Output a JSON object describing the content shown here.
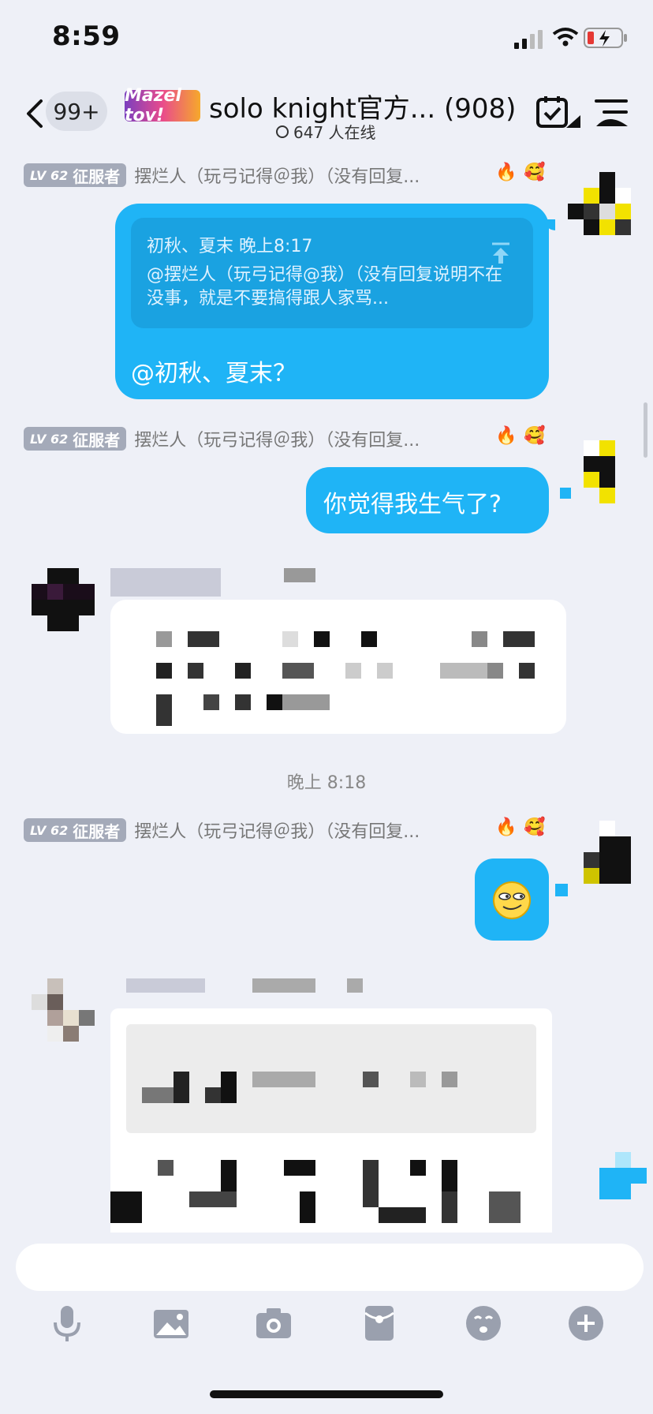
{
  "status_bar": {
    "time": "8:59"
  },
  "header": {
    "unread_badge": "99+",
    "group_logo_text": "Mazel tov!",
    "title": "solo knight官方... (908)",
    "online_count": "647 人在线"
  },
  "messages": {
    "sender": {
      "level_badge": "LV 62",
      "title": "征服者",
      "name": "摆烂人（玩弓记得＠我）（没有回复..."
    },
    "quote": {
      "meta": "初秋、夏末 晚上8:17",
      "text": "@摆烂人（玩弓记得@我）（没有回复说明不在 没事，就是不要搞得跟人家骂..."
    },
    "reply_text": "@初秋、夏末？",
    "second_text": "你觉得我生气了?",
    "time_separator": "晚上 8:18"
  },
  "icons": {
    "back": "chevron-left-icon",
    "checkin": "calendar-check-icon",
    "menu": "menu-icon",
    "voice": "microphone-icon",
    "image": "image-icon",
    "camera": "camera-icon",
    "redpacket": "red-packet-icon",
    "emoji": "emoji-icon",
    "more": "plus-circle-icon"
  },
  "colors": {
    "bubble": "#1fb4f6",
    "background": "#eef0f7",
    "level_badge": "#a4aab9"
  }
}
